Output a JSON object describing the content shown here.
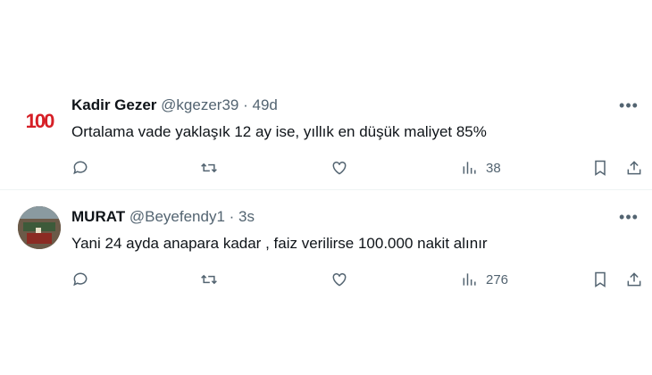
{
  "tweets": [
    {
      "avatar_icon": "brand-logo-icon",
      "avatar_text": "100",
      "name": "Kadir Gezer",
      "handle": "@kgezer39",
      "separator": "·",
      "time": "49d",
      "text": "Ortalama vade yaklaşık 12 ay ise, yıllık en düşük maliyet 85%",
      "views": "38"
    },
    {
      "avatar_icon": "user-photo-avatar",
      "name": "MURAT",
      "handle": "@Beyefendy1",
      "separator": "·",
      "time": "3s",
      "text": "Yani 24 ayda anapara kadar , faiz verilirse 100.000 nakit alınır",
      "views": "276"
    }
  ],
  "icons": {
    "reply": "reply-icon",
    "retweet": "retweet-icon",
    "like": "heart-icon",
    "views": "views-chart-icon",
    "bookmark": "bookmark-icon",
    "share": "share-icon",
    "more": "more-icon"
  },
  "colors": {
    "text": "#0f1419",
    "secondary": "#536471",
    "divider": "#eff3f4",
    "logo_red": "#d61f26"
  }
}
